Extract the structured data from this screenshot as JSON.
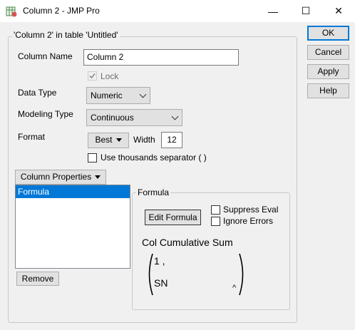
{
  "window": {
    "title": "Column 2 - JMP Pro",
    "min_glyph": "—",
    "max_glyph": "☐",
    "close_glyph": "✕",
    "icon": "jmp-app-icon"
  },
  "group": {
    "legend": "'Column 2' in table 'Untitled'"
  },
  "fields": {
    "column_name_label": "Column Name",
    "column_name_value": "Column 2",
    "lock_label": "Lock",
    "lock_checked": true,
    "data_type_label": "Data Type",
    "data_type_value": "Numeric",
    "modeling_type_label": "Modeling Type",
    "modeling_type_value": "Continuous",
    "format_label": "Format",
    "format_value": "Best",
    "width_label": "Width",
    "width_value": "12",
    "thousands_label": "Use thousands separator ( )",
    "thousands_checked": false
  },
  "column_properties": {
    "label": "Column Properties",
    "items": [
      "Formula"
    ],
    "remove_label": "Remove"
  },
  "formula": {
    "legend": "Formula",
    "edit_label": "Edit Formula",
    "suppress_label": "Suppress Eval",
    "ignore_label": "Ignore Errors",
    "function_name": "Col Cumulative Sum",
    "arg1": "1 ,",
    "arg2": "SN",
    "caret": "^"
  },
  "buttons": {
    "ok": "OK",
    "cancel": "Cancel",
    "apply": "Apply",
    "help": "Help"
  }
}
